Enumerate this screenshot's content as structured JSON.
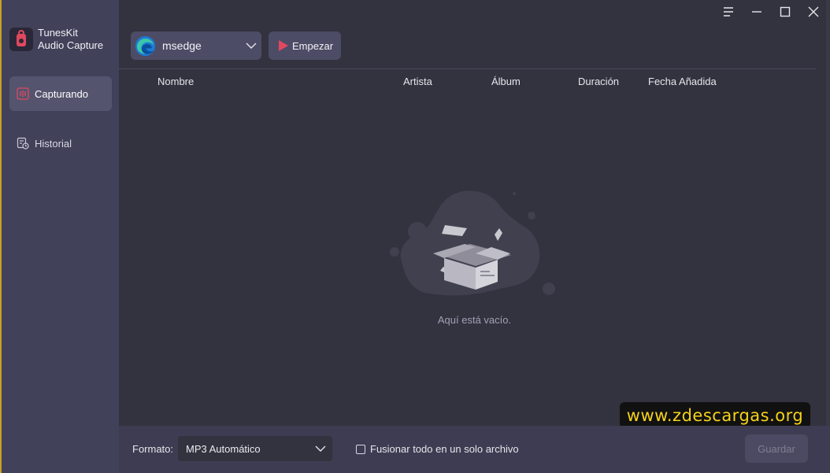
{
  "app": {
    "name_line1": "TunesKit",
    "name_line2": "Audio Capture"
  },
  "sidebar": {
    "items": [
      {
        "label": "Capturando",
        "icon": "capture-icon",
        "active": true
      },
      {
        "label": "Historial",
        "icon": "history-icon",
        "active": false
      }
    ]
  },
  "toolbar": {
    "source_value": "msedge",
    "start_label": "Empezar"
  },
  "table": {
    "columns": [
      "Nombre",
      "Artista",
      "Álbum",
      "Duración",
      "Fecha Añadida"
    ]
  },
  "empty": {
    "message": "Aquí está vacío."
  },
  "bottom": {
    "format_label": "Formato:",
    "format_value": "MP3 Automático",
    "merge_label": "Fusionar todo en un solo archivo",
    "merge_checked": false,
    "save_label": "Guardar"
  },
  "watermark": {
    "text": "www.zdescargas.org"
  },
  "colors": {
    "background": "#33323f",
    "sidebar": "#42415a",
    "accent_red": "#e0485f",
    "watermark_text": "#f5d21a"
  }
}
